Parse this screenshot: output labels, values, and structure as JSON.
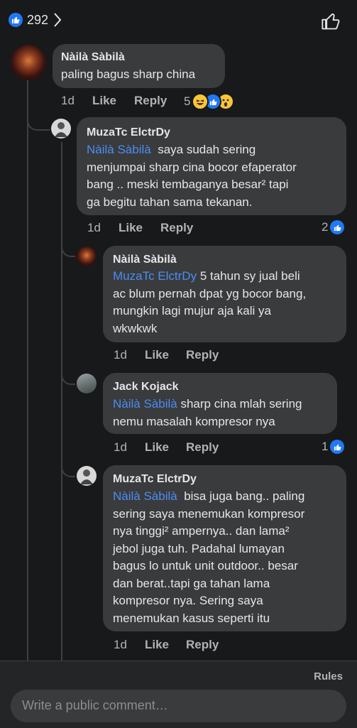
{
  "header": {
    "reaction_count": "292"
  },
  "comments": [
    {
      "author": "Nàilà Sàbilà",
      "mention": "",
      "text": "paling bagus sharp china",
      "time": "1d",
      "like": "Like",
      "reply": "Reply",
      "reactions": "5"
    },
    {
      "author": "MuzaTc ElctrDy",
      "mention": "Nàilà Sàbilà",
      "lines": [
        "saya sudah sering",
        "menjumpai sharp cina bocor efaperator",
        "bang .. meski tembaganya besar² tapi",
        "ga begitu tahan sama tekanan."
      ],
      "time": "1d",
      "like": "Like",
      "reply": "Reply",
      "reactions": "2"
    },
    {
      "author": "Nàilà Sàbilà",
      "mention": "MuzaTc ElctrDy",
      "lines": [
        "5 tahun sy jual beli",
        "ac blum pernah dpat yg bocor bang,",
        "mungkin lagi mujur aja kali ya",
        "wkwkwk"
      ],
      "time": "1d",
      "like": "Like",
      "reply": "Reply"
    },
    {
      "author": "Jack Kojack",
      "mention": "Nàilà Sàbilà",
      "lines": [
        "sharp cina mlah sering",
        "nemu masalah kompresor nya"
      ],
      "time": "1d",
      "like": "Like",
      "reply": "Reply",
      "reactions": "1"
    },
    {
      "author": "MuzaTc ElctrDy",
      "mention": "Nàilà Sàbilà",
      "lines": [
        "bisa juga bang.. paling",
        "sering saya menemukan kompresor",
        "nya tinggi² ampernya.. dan lama²",
        "jebol juga tuh. Padahal lumayan",
        "bagus lo untuk unit outdoor..  besar",
        "dan berat..tapi ga tahan lama",
        "kompresor nya. Sering saya",
        "menemukan kasus seperti itu"
      ],
      "time": "1d",
      "like": "Like",
      "reply": "Reply"
    }
  ],
  "footer": {
    "rules": "Rules",
    "input_placeholder": "Write a public comment…"
  },
  "colors": {
    "background": "#18191a",
    "bubble": "#3a3b3c",
    "mention": "#4a8df6",
    "like_blue": "#2078f4"
  }
}
